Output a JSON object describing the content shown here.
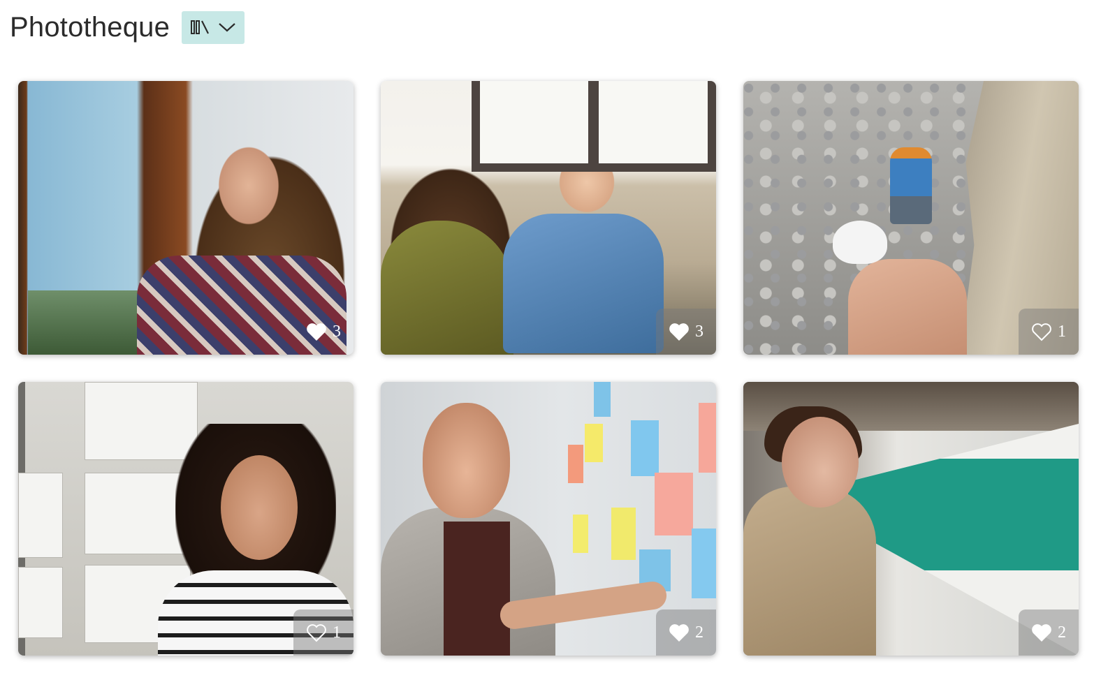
{
  "header": {
    "title": "Phototheque",
    "view_toggle": {
      "icon": "library-icon",
      "chevron": "chevron-down-icon",
      "background": "#c7e8e6"
    }
  },
  "photos": [
    {
      "subject": "woman-by-window",
      "likes": "3",
      "liked": true,
      "badge_shaded": false
    },
    {
      "subject": "mother-and-child",
      "likes": "3",
      "liked": true,
      "badge_shaded": true
    },
    {
      "subject": "climber",
      "likes": "1",
      "liked": false,
      "badge_shaded": true
    },
    {
      "subject": "woman-whiteboard",
      "likes": "1",
      "liked": false,
      "badge_shaded": true
    },
    {
      "subject": "man-sticky-notes",
      "likes": "2",
      "liked": true,
      "badge_shaded": true
    },
    {
      "subject": "woman-metro",
      "likes": "2",
      "liked": true,
      "badge_shaded": true
    }
  ],
  "colors": {
    "title_text": "#2b2b2b",
    "badge_text": "#ffffff"
  }
}
